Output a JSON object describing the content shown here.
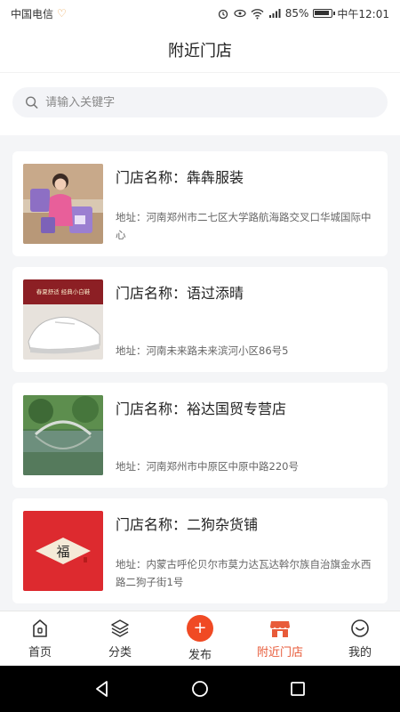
{
  "status_bar": {
    "carrier": "中国电信",
    "battery": "85%",
    "time": "中午12:01"
  },
  "header": {
    "title": "附近门店"
  },
  "search": {
    "placeholder": "请输入关键字"
  },
  "stores": [
    {
      "name": "门店名称：犇犇服装",
      "address": "地址：河南郑州市二七区大学路航海路交叉口华城国际中心"
    },
    {
      "name": "门店名称：语过添晴",
      "address": "地址：河南未来路未来滨河小区86号5"
    },
    {
      "name": "门店名称：裕达国贸专营店",
      "address": "地址：河南郑州市中原区中原中路220号"
    },
    {
      "name": "门店名称：二狗杂货铺",
      "address": "地址：内蒙古呼伦贝尔市莫力达瓦达斡尔族自治旗金水西路二狗子街1号"
    }
  ],
  "thumb_texts": {
    "shoe_caption": "春夏舒适 经典小白鞋",
    "fu_char": "福"
  },
  "tab_bar": {
    "items": [
      {
        "label": "首页",
        "icon": "home-icon"
      },
      {
        "label": "分类",
        "icon": "layers-icon"
      },
      {
        "label": "发布",
        "icon": "plus-icon"
      },
      {
        "label": "附近门店",
        "icon": "store-icon",
        "active": true
      },
      {
        "label": "我的",
        "icon": "profile-icon"
      }
    ],
    "publish_symbol": "+"
  },
  "colors": {
    "accent": "#e85b3a",
    "publish": "#f04a24",
    "background": "#f4f5f7"
  }
}
